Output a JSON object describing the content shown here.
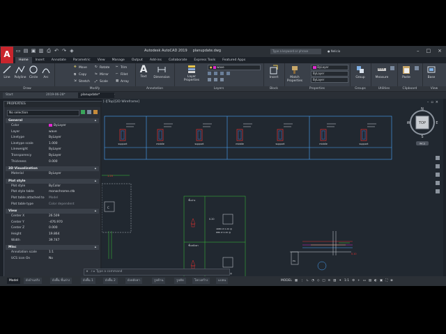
{
  "app": {
    "title": "Autodesk AutoCAD 2019",
    "file": "planupdate.dwg",
    "app_letter": "A",
    "search_placeholder": "Type a keyword or phrase",
    "user": "Nelicia"
  },
  "ribbon": {
    "tabs": [
      "Home",
      "Insert",
      "Annotate",
      "Parametric",
      "View",
      "Manage",
      "Output",
      "Add-ins",
      "Collaborate",
      "Express Tools",
      "Featured Apps"
    ],
    "active_tab": "Home",
    "draw": {
      "label": "Draw",
      "line": "Line",
      "polyline": "Polyline",
      "circle": "Circle",
      "arc": "Arc"
    },
    "modify": {
      "label": "Modify",
      "move": "Move",
      "rotate": "Rotate",
      "trim": "Trim",
      "copy": "Copy",
      "mirror": "Mirror",
      "fillet": "Fillet",
      "stretch": "Stretch",
      "scale": "Scale",
      "array": "Array"
    },
    "annotation": {
      "label": "Annotation",
      "text": "Text",
      "dimension": "Dimension"
    },
    "layers": {
      "label": "Layers",
      "layer_properties": "Layer Properties",
      "current_layer": "wave"
    },
    "block": {
      "label": "Block",
      "insert": "Insert"
    },
    "properties": {
      "label": "Properties",
      "match": "Match Properties",
      "color": "ByLayer",
      "linetype": "ByLayer",
      "lineweight": "ByLayer"
    },
    "groups": {
      "label": "Groups",
      "group": "Group"
    },
    "utilities": {
      "label": "Utilities",
      "measure": "Measure"
    },
    "clipboard": {
      "label": "Clipboard",
      "paste": "Paste"
    },
    "view": {
      "label": "View",
      "base": "Base"
    }
  },
  "doc_tabs": [
    "Start",
    "2019-06-28*",
    "planupdate*"
  ],
  "active_doc": "planupdate*",
  "properties": {
    "title": "PROPERTIES",
    "selection": "No selection",
    "general": {
      "label": "General",
      "rows": [
        {
          "k": "Color",
          "v": "ByLayer"
        },
        {
          "k": "Layer",
          "v": "wave"
        },
        {
          "k": "Linetype",
          "v": "ByLayer"
        },
        {
          "k": "Linetype scale",
          "v": "1.000"
        },
        {
          "k": "Lineweight",
          "v": "ByLayer"
        },
        {
          "k": "Transparency",
          "v": "ByLayer"
        },
        {
          "k": "Thickness",
          "v": "0.000"
        }
      ]
    },
    "visualization": {
      "label": "3D Visualization",
      "rows": [
        {
          "k": "Material",
          "v": "ByLayer"
        }
      ]
    },
    "plot_style": {
      "label": "Plot style",
      "rows": [
        {
          "k": "Plot style",
          "v": "ByColor"
        },
        {
          "k": "Plot style table",
          "v": "monochrome.ctb"
        },
        {
          "k": "Plot table attached to",
          "v": "Model"
        },
        {
          "k": "Plot table type",
          "v": "Color dependent"
        }
      ]
    },
    "view": {
      "label": "View",
      "rows": [
        {
          "k": "Center X",
          "v": "26.509"
        },
        {
          "k": "Center Y",
          "v": "-476.970"
        },
        {
          "k": "Center Z",
          "v": "0.000"
        },
        {
          "k": "Height",
          "v": "19.864"
        },
        {
          "k": "Width",
          "v": "39.747"
        }
      ]
    },
    "misc": {
      "label": "Misc",
      "rows": [
        {
          "k": "Annotation scale",
          "v": "1:1"
        },
        {
          "k": "UCS icon On",
          "v": "No"
        }
      ]
    }
  },
  "viewport": {
    "label": "[-][Top][2D Wireframe]",
    "viewcube": {
      "top": "TOP",
      "n": "N",
      "s": "S",
      "e": "E",
      "w": "W",
      "wcs": "WCS"
    },
    "drawing_labels": {
      "support": "support",
      "middle": "middle"
    }
  },
  "command": {
    "placeholder": "Type a command"
  },
  "layout_tabs": [
    "Model",
    "ผังบ้านจริง",
    "ผังพื้น ชั้นล่าง",
    "ผังพื้น 1",
    "ผังพื้น 2",
    "ผังหลังคา",
    "รูปด้าน",
    "รูปตัด",
    "โครงสร้าง",
    "แปลน"
  ],
  "status": {
    "model": "MODEL",
    "scale": "1:1"
  },
  "colors": {
    "accent_red": "#c9252c",
    "magenta": "#e02ad0",
    "drawing_red": "#e8312f",
    "drawing_blue": "#3d7fe0",
    "drawing_green": "#27a52a"
  }
}
